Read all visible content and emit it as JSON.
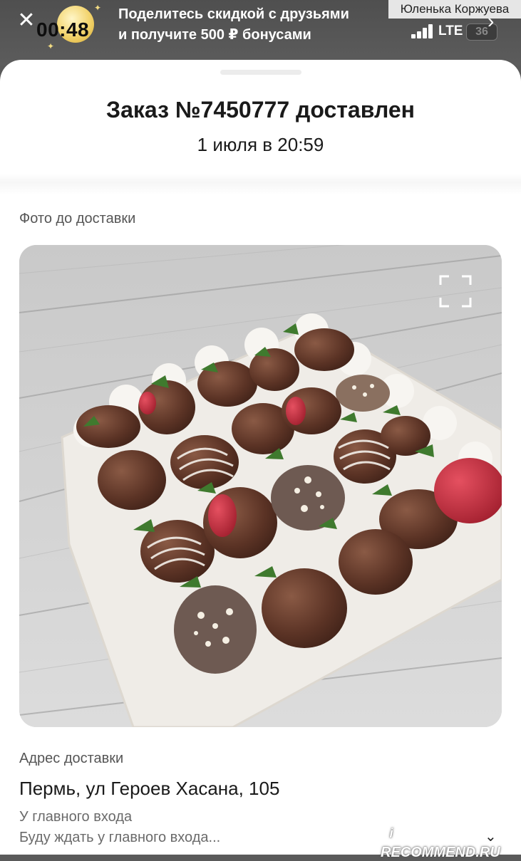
{
  "banner": {
    "close_icon": "close-icon",
    "time": "00:48",
    "promo_text_line1": "Поделитесь скидкой с друзьями",
    "promo_text_line2": "и получите 500 ₽ бонусами",
    "user_name": "Юленька Коржуева",
    "network": "LTE",
    "battery": "36",
    "chevron_icon": "chevron-right-icon"
  },
  "order": {
    "title": "Заказ №7450777 доставлен",
    "delivered_at": "1 июля в 20:59"
  },
  "photo_section": {
    "label": "Фото до доставки",
    "expand_icon": "fullscreen-icon"
  },
  "address_section": {
    "label": "Адрес доставки",
    "address": "Пермь, ул Героев Хасана, 105",
    "entrance": "У главного входа",
    "comment": "Буду ждать у главного входа...",
    "expand_icon": "chevron-down-icon"
  },
  "watermark": {
    "text": "RECOMMEND.RU",
    "badge": "i"
  },
  "colors": {
    "banner_bg": "#555555",
    "sheet_bg": "#ffffff",
    "text_primary": "#1a1a1a",
    "text_secondary": "#6a6a6a",
    "coin": "#f2d36b"
  }
}
